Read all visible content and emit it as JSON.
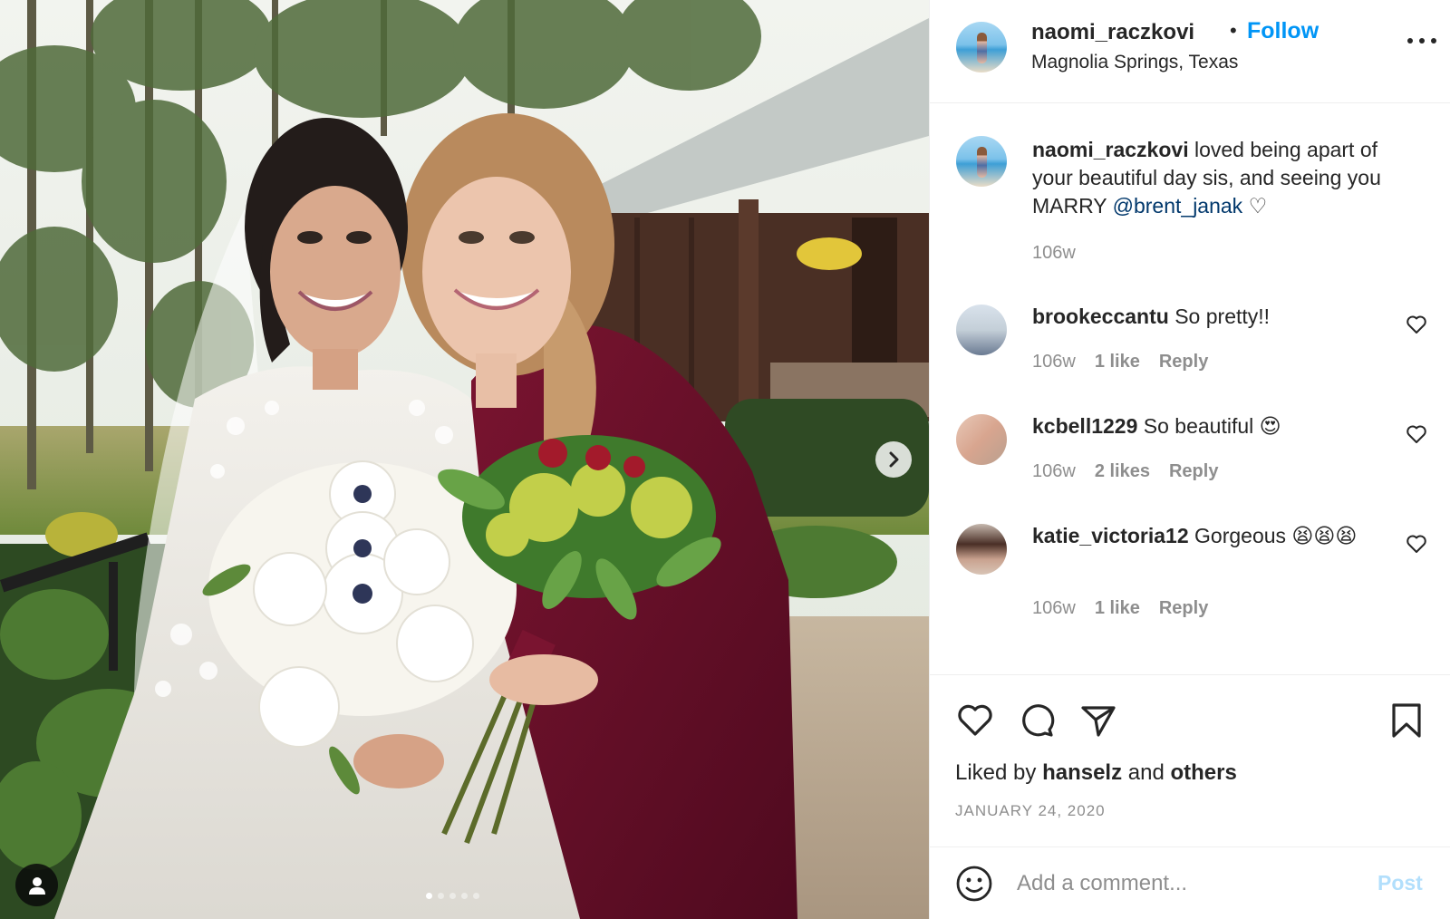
{
  "header": {
    "username": "naomi_raczkovi",
    "separator": "•",
    "follow_label": "Follow",
    "location": "Magnolia Springs, Texas"
  },
  "caption": {
    "username": "naomi_raczkovi",
    "text": "loved being apart of your beautiful day sis, and seeing you MARRY",
    "mention": "@brent_janak",
    "trailing": "♡",
    "age": "106w"
  },
  "comments": [
    {
      "username": "brookeccantu",
      "text": "So pretty!!",
      "age": "106w",
      "likes": "1 like",
      "reply": "Reply"
    },
    {
      "username": "kcbell1229",
      "text": "So beautiful 😍",
      "age": "106w",
      "likes": "2 likes",
      "reply": "Reply"
    },
    {
      "username": "katie_victoria12",
      "text": "Gorgeous 😫😫😫",
      "age": "106w",
      "likes": "1 like",
      "reply": "Reply"
    }
  ],
  "actions": {
    "icons": [
      "heart-icon",
      "comment-icon",
      "share-icon",
      "bookmark-icon"
    ],
    "liked_prefix": "Liked by",
    "liked_user": "hanselz",
    "liked_and": "and",
    "liked_others": "others",
    "date": "JANUARY 24, 2020"
  },
  "composer": {
    "placeholder": "Add a comment...",
    "post_label": "Post"
  },
  "carousel": {
    "slide_count": 5,
    "active_index": 0
  },
  "colors": {
    "accent": "#0095f6",
    "post_disabled": "#b2dffc",
    "meta": "#8e8e8e",
    "text": "#262626",
    "mention": "#00376b"
  }
}
